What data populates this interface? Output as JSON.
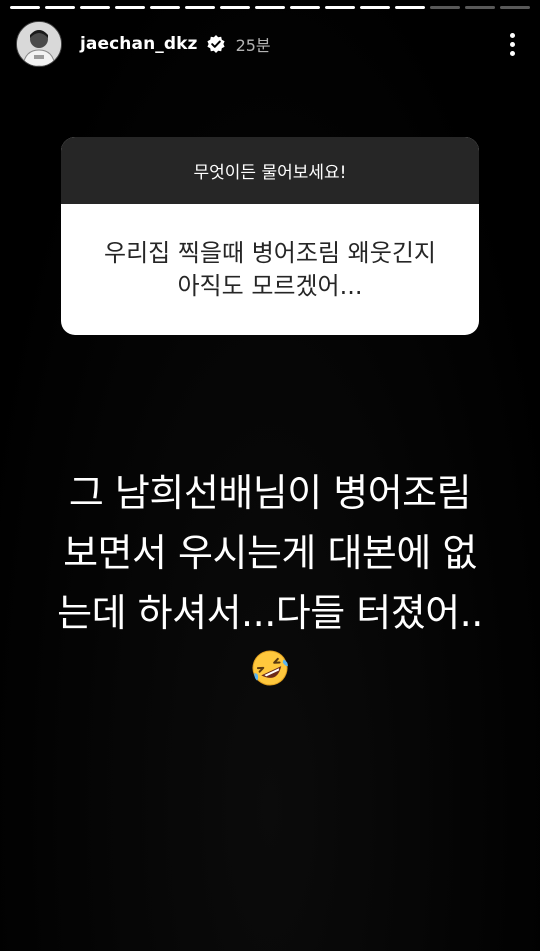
{
  "progress": {
    "segments": 15,
    "completed": 12
  },
  "header": {
    "username": "jaechan_dkz",
    "time": "25분"
  },
  "question": {
    "prompt": "무엇이든 물어보세요!",
    "lines": [
      "우리집 찍을때 병어조림 왜웃긴지",
      "아직도 모르겠어..."
    ]
  },
  "answer": {
    "lines": [
      "그 남희선배님이 병어조림",
      "보면서 우시는게 대본에 없",
      "는데 하셔서...다들 터졌어.."
    ],
    "emoji": "rolling-on-floor-laughing"
  },
  "colors": {
    "background": "#000000",
    "card_header": "#262626",
    "card_body": "#ffffff",
    "text_dark": "#262626"
  }
}
